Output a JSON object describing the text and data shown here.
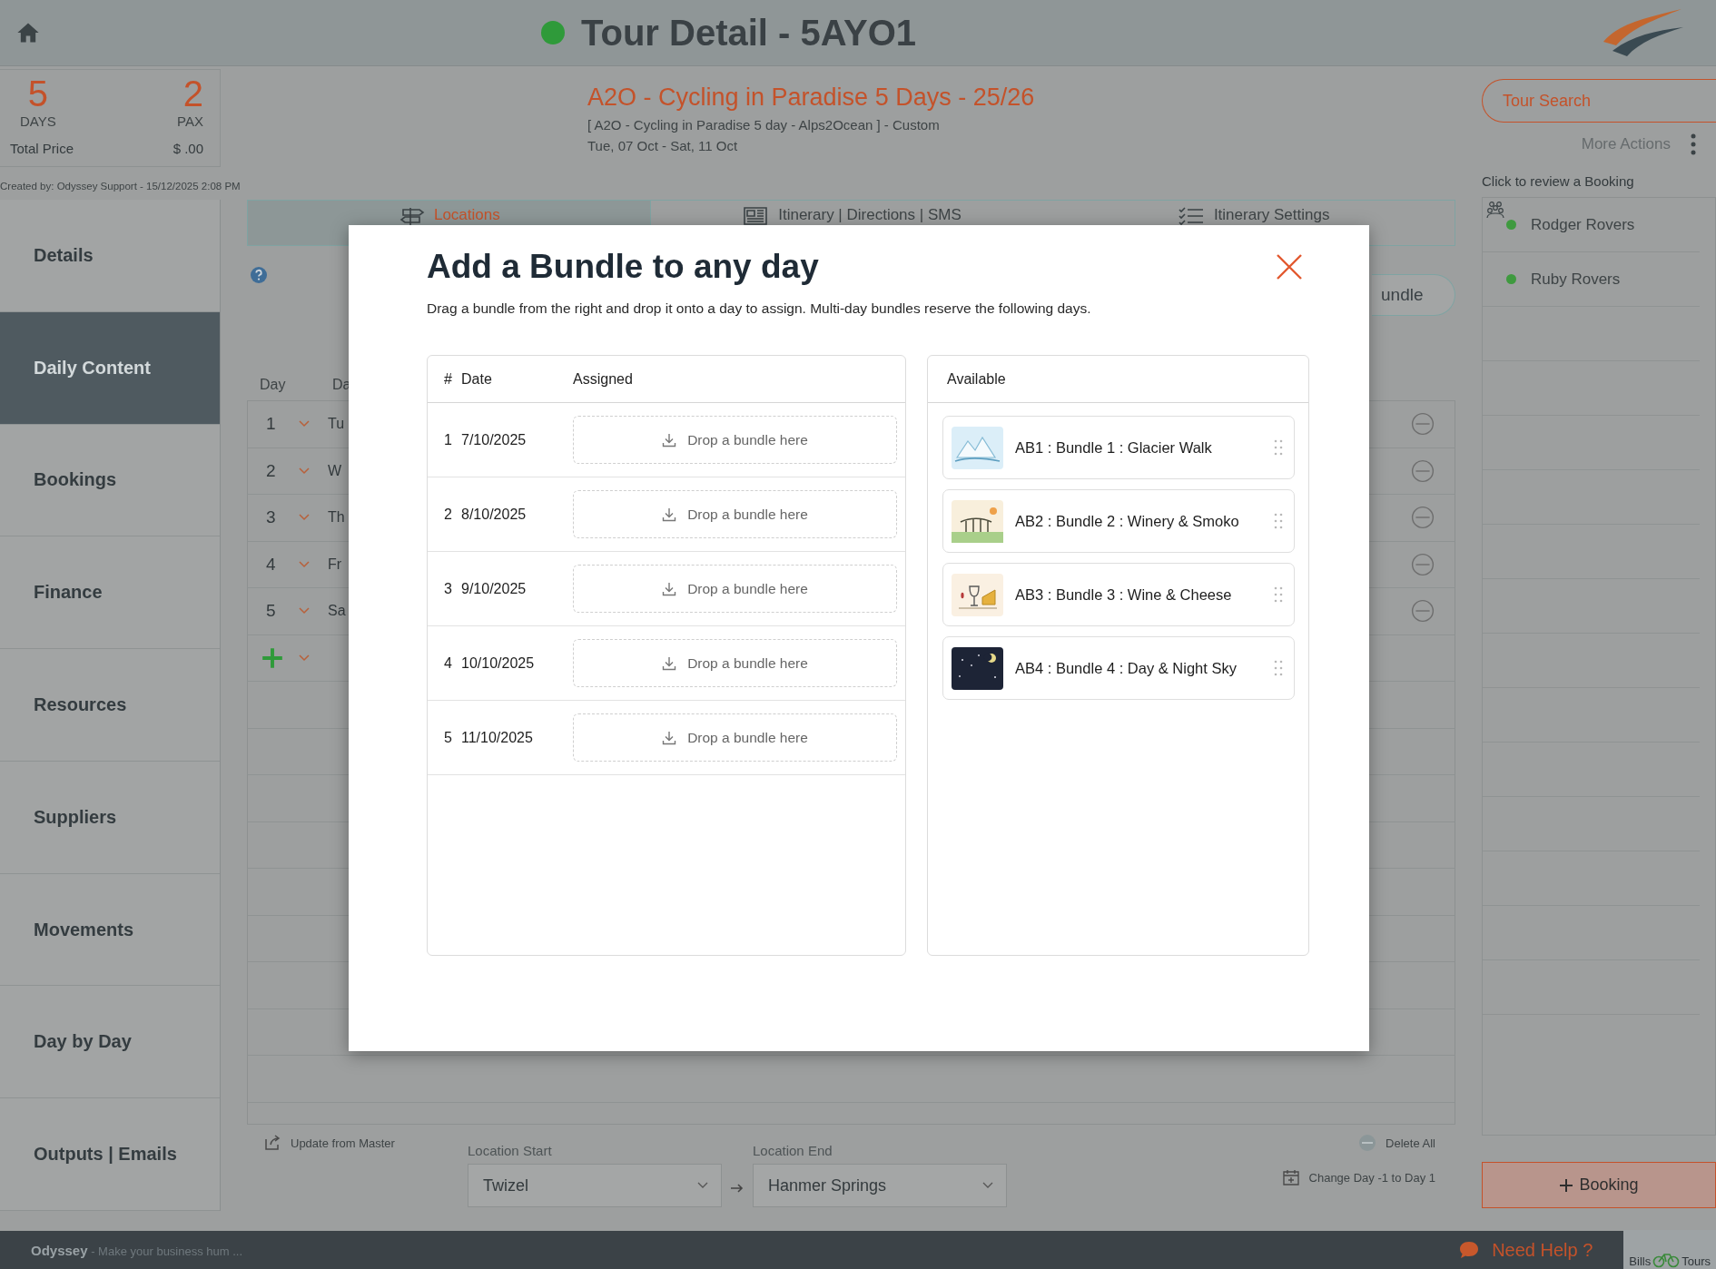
{
  "header": {
    "title": "Tour Detail - 5AYO1"
  },
  "summary": {
    "days": "5",
    "days_label": "DAYS",
    "pax": "2",
    "pax_label": "PAX",
    "price_label": "Total Price",
    "price": "$ .00"
  },
  "tour": {
    "name": "A2O - Cycling in Paradise 5 Days - 25/26",
    "subtitle": "[ A2O - Cycling in Paradise 5 day - Alps2Ocean ] - Custom",
    "dates": "Tue, 07 Oct  - Sat, 11 Oct"
  },
  "actions": {
    "search": "Tour Search",
    "more": "More Actions"
  },
  "created_by": "Created by: Odyssey Support - 15/12/2025 2:08 PM",
  "sidebar": {
    "items": [
      {
        "label": "Details",
        "selected": false
      },
      {
        "label": "Daily Content",
        "selected": true
      },
      {
        "label": "Bookings",
        "selected": false
      },
      {
        "label": "Finance",
        "selected": false
      },
      {
        "label": "Resources",
        "selected": false
      },
      {
        "label": "Suppliers",
        "selected": false
      },
      {
        "label": "Movements",
        "selected": false
      },
      {
        "label": "Day by Day",
        "selected": false
      },
      {
        "label": "Outputs | Emails",
        "selected": false
      }
    ]
  },
  "tabs": [
    {
      "label": "Locations",
      "selected": true
    },
    {
      "label": "Itinerary | Directions | SMS",
      "selected": false
    },
    {
      "label": "Itinerary Settings",
      "selected": false
    }
  ],
  "bundle_button": "undle",
  "days": {
    "columns": [
      "Day",
      "Da"
    ],
    "rows": [
      {
        "day": "1",
        "date": "Tu"
      },
      {
        "day": "2",
        "date": "W"
      },
      {
        "day": "3",
        "date": "Th"
      },
      {
        "day": "4",
        "date": "Fr"
      },
      {
        "day": "5",
        "date": "Sa"
      }
    ]
  },
  "bottom": {
    "update": "Update from Master",
    "start_label": "Location Start",
    "start": "Twizel",
    "end_label": "Location End",
    "end": "Hanmer Springs",
    "delete": "Delete All",
    "change_day": "Change Day -1 to Day 1"
  },
  "bookings": {
    "title": "Click to review a Booking",
    "items": [
      {
        "name": "Rodger Rovers",
        "color": "#3f9a3f"
      },
      {
        "name": "Ruby Rovers",
        "color": "#3f9a3f"
      }
    ],
    "add": "Booking"
  },
  "footer": {
    "brand": "Odyssey",
    "tagline": "- Make your business hum ...",
    "help": "Need Help ?",
    "logo_left": "Bills",
    "logo_right": "Tours"
  },
  "modal": {
    "title": "Add a Bundle to any day",
    "description": "Drag a bundle from the right and drop it onto a day to assign. Multi-day bundles reserve the following days.",
    "assigned": {
      "columns": [
        "#",
        "Date",
        "Assigned"
      ],
      "rows": [
        {
          "num": "1",
          "date": "7/10/2025",
          "drop": "Drop a bundle here"
        },
        {
          "num": "2",
          "date": "8/10/2025",
          "drop": "Drop a bundle here"
        },
        {
          "num": "3",
          "date": "9/10/2025",
          "drop": "Drop a bundle here"
        },
        {
          "num": "4",
          "date": "10/10/2025",
          "drop": "Drop a bundle here"
        },
        {
          "num": "5",
          "date": "11/10/2025",
          "drop": "Drop a bundle here"
        }
      ]
    },
    "available": {
      "title": "Available",
      "items": [
        {
          "label": "AB1 : Bundle 1 : Glacier Walk"
        },
        {
          "label": "AB2 : Bundle 2 : Winery & Smoko"
        },
        {
          "label": "AB3 : Bundle 3 : Wine & Cheese"
        },
        {
          "label": "AB4 : Bundle 4 : Day & Night Sky"
        }
      ]
    }
  }
}
